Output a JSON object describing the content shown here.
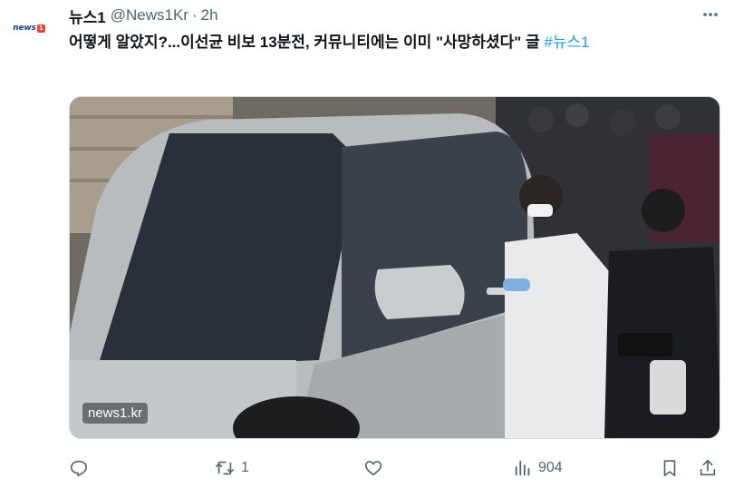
{
  "tweet": {
    "avatar_logo_text": "news",
    "display_name": "뉴스1",
    "handle": "@News1Kr",
    "separator": "·",
    "time": "2h",
    "text": "어떻게 알았지?...이선균 비보 13분전, 커뮤니티에는 이미 \"사망하셨다\" 글 ",
    "hashtag": "#뉴스1",
    "media_watermark": "news1.kr"
  },
  "actions": {
    "reply_count": "",
    "retweet_count": "1",
    "like_count": "",
    "views_count": "904"
  },
  "icons": {
    "more": "more-dots-icon",
    "reply": "reply-icon",
    "retweet": "retweet-icon",
    "like": "heart-icon",
    "views": "views-chart-icon",
    "bookmark": "bookmark-icon",
    "share": "share-icon"
  },
  "colors": {
    "accent": "#1d9bf0",
    "secondary_text": "#536471",
    "primary_text": "#0f1419",
    "border": "#cfd9de"
  }
}
